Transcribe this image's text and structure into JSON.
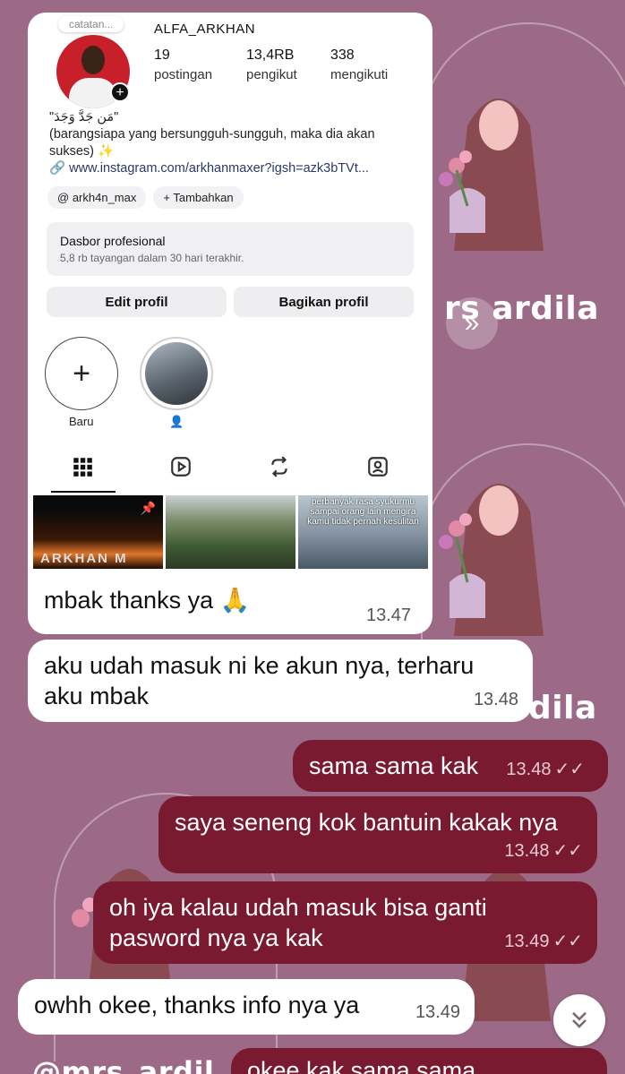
{
  "wallpaper": {
    "brand_text_1": "rs  ardila",
    "brand_text_2": "dila",
    "bottom_text": "@mrs_ardil"
  },
  "ig_card": {
    "note": "catatan...",
    "username": "ALFA_ARKHAN",
    "stats": [
      {
        "num": "19",
        "label": "postingan"
      },
      {
        "num": "13,4RB",
        "label": "pengikut"
      },
      {
        "num": "338",
        "label": "mengikuti"
      }
    ],
    "bio_arabic": "\"مَن جَدَّ وَجَدَ\"",
    "bio_line": "(barangsiapa yang bersungguh-sungguh, maka dia akan sukses) ✨",
    "bio_link": "www.instagram.com/arkhanmaxer?igsh=azk3bTVt...",
    "threads_chip": "arkh4n_max",
    "add_chip": "Tambahkan",
    "dashboard_title": "Dasbor profesional",
    "dashboard_sub": "5,8 rb tayangan dalam 30 hari terakhir.",
    "edit_profile": "Edit profil",
    "share_profile": "Bagikan profil",
    "highlight_new": "Baru",
    "highlight_story_label": "👤",
    "thumb3_text": "perbanyak rasa syukurmu sampai orang lain mengira kamu tidak pernah kesulitan",
    "thumb1_text": "ARKHAN M",
    "caption": "mbak thanks ya 🙏",
    "caption_time": "13.47"
  },
  "messages": [
    {
      "dir": "in",
      "text_1": "aku udah masuk ni ke akun nya, terharu",
      "text_2": "aku mbak",
      "time": "13.48"
    },
    {
      "dir": "out",
      "text": "sama sama kak",
      "time": "13.48",
      "ticks": "✓✓"
    },
    {
      "dir": "out",
      "text": "saya seneng kok bantuin kakak nya",
      "time": "13.48",
      "ticks": "✓✓"
    },
    {
      "dir": "out",
      "text_1": "oh iya kalau udah masuk bisa ganti",
      "text_2": "pasword nya ya kak",
      "time": "13.49",
      "ticks": "✓✓"
    },
    {
      "dir": "in",
      "text": "owhh okee, thanks info nya ya",
      "time": "13.49"
    },
    {
      "dir": "out",
      "text": "okee kak sama sama"
    }
  ],
  "colors": {
    "background": "#9c6a87",
    "outgoing": "#7a1a30",
    "incoming": "#ffffff"
  }
}
